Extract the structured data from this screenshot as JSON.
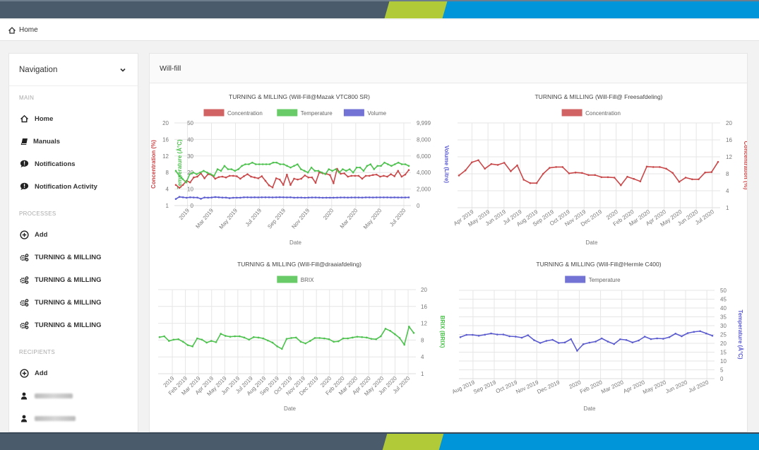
{
  "breadcrumb": {
    "icon": "home-icon",
    "label": "Home"
  },
  "sidebar": {
    "title": "Navigation",
    "sections": [
      {
        "label": "MAIN",
        "items": [
          {
            "label": "Home",
            "icon": "home-icon"
          },
          {
            "label": "Manuals",
            "icon": "book-icon"
          },
          {
            "label": "Notifications",
            "icon": "alert-bubble-icon"
          },
          {
            "label": "Notification Activity",
            "icon": "alert-bubble-icon"
          }
        ]
      },
      {
        "label": "PROCESSES",
        "items": [
          {
            "label": "Add",
            "icon": "plus-circle-icon"
          },
          {
            "label": "TURNING & MILLING",
            "icon": "cogs-icon"
          },
          {
            "label": "TURNING & MILLING",
            "icon": "cogs-icon"
          },
          {
            "label": "TURNING & MILLING",
            "icon": "cogs-icon"
          },
          {
            "label": "TURNING & MILLING",
            "icon": "cogs-icon"
          }
        ]
      },
      {
        "label": "RECIPIENTS",
        "items": [
          {
            "label": "Add",
            "icon": "plus-circle-icon"
          },
          {
            "label": "[redacted]",
            "icon": "user-icon",
            "blurred": true
          },
          {
            "label": "[redacted]",
            "icon": "user-icon",
            "blurred": true
          }
        ]
      }
    ]
  },
  "card": {
    "title": "Will-fill"
  },
  "colors": {
    "red": "#c9484a",
    "green": "#4ec24e",
    "blue": "#5b5bd0",
    "slate": "#4a5b6b",
    "lime": "#b1ca38",
    "cyan": "#0095d9"
  },
  "chart_data": [
    {
      "type": "line",
      "title": "TURNING & MILLING (Will-Fill@Mazak VTC800 SR)",
      "xlabel": "Date",
      "x_ticks": [
        "2019",
        "Mar 2019",
        "May 2019",
        "Jul 2019",
        "Sep 2019",
        "Nov 2019",
        "2020",
        "Mar 2020",
        "May 2020",
        "Jul 2020"
      ],
      "legend": [
        "Concentration",
        "Temperature",
        "Volume"
      ],
      "legend_position": "top",
      "grid": true,
      "axes": [
        {
          "id": "conc",
          "side": "left-outer",
          "label": "Concentration (%)",
          "color": "#c9484a",
          "ticks": [
            "20",
            "16",
            "12",
            "8",
            "4",
            "1"
          ],
          "range": [
            0,
            20
          ]
        },
        {
          "id": "temp",
          "side": "left-inner",
          "label": "Temperature (Â°C)",
          "color": "#4ec24e",
          "ticks": [
            "50",
            "40",
            "30",
            "20",
            "10",
            "0"
          ],
          "range": [
            0,
            50
          ]
        },
        {
          "id": "vol",
          "side": "right",
          "label": "Volume (Litre)",
          "color": "#5b5bd0",
          "ticks": [
            "9,999",
            "8,000",
            "6,000",
            "4,000",
            "2,000",
            "0"
          ],
          "range": [
            0,
            9999
          ]
        }
      ],
      "series": [
        {
          "name": "Concentration",
          "axis": "conc",
          "color": "#c9484a",
          "values": [
            5.0,
            4.3,
            5.0,
            6.0,
            5.6,
            6.8,
            7.0,
            7.8,
            6.6,
            7.6,
            7.4,
            6.5,
            6.9,
            7.0,
            6.8,
            7.2,
            7.2,
            7.1,
            6.5,
            7.1,
            7.6,
            7.0,
            6.8,
            6.6,
            7.1,
            6.0,
            4.9,
            4.4,
            6.6,
            6.3,
            5.0,
            7.5,
            5.0,
            6.5,
            6.3,
            6.5,
            7.3,
            6.8,
            6.8,
            5.5,
            8.0,
            7.8,
            7.7,
            7.4,
            5.4,
            8.9,
            7.7,
            7.8,
            7.0,
            7.2,
            7.2,
            7.2,
            6.5,
            7.2,
            7.2,
            7.4,
            7.5,
            7.0,
            7.2,
            7.0,
            7.6,
            7.1,
            8.4,
            7.0,
            7.5,
            8.6
          ]
        },
        {
          "name": "Temperature",
          "axis": "temp",
          "color": "#4ec24e",
          "values": [
            21,
            18,
            16,
            14,
            19,
            20,
            19,
            20,
            21,
            20,
            19,
            18,
            22,
            21,
            24,
            22,
            22,
            21,
            22,
            24,
            25,
            25,
            26,
            25,
            25,
            25,
            25,
            25,
            26,
            26,
            25,
            25,
            24,
            23,
            24,
            25,
            22,
            21,
            20,
            23,
            21,
            21,
            20,
            19,
            22,
            21,
            22,
            20,
            22,
            21,
            22,
            20,
            23,
            23,
            21,
            24,
            25,
            22,
            24,
            24,
            26,
            25,
            24,
            25,
            26,
            25,
            25,
            24
          ]
        },
        {
          "name": "Volume",
          "axis": "vol",
          "color": "#5b5bd0",
          "values": [
            800,
            1050,
            1000,
            950,
            1000,
            980,
            970,
            820,
            980,
            960,
            980,
            1030,
            1000,
            970,
            970,
            900,
            950,
            960,
            960,
            1000,
            1000,
            990,
            1000,
            990,
            1000,
            1000,
            1000,
            990,
            1000,
            1010,
            1000,
            990,
            1000,
            960,
            970,
            970,
            950,
            970,
            980,
            980,
            970,
            950,
            960,
            960,
            960,
            970,
            980,
            980,
            970,
            980,
            980,
            980,
            970,
            990,
            990,
            980,
            990,
            990,
            990,
            990,
            980,
            990,
            980,
            980,
            980,
            990
          ]
        }
      ]
    },
    {
      "type": "line",
      "title": "TURNING & MILLING (Will-Fill@ Freesafdeling)",
      "xlabel": "Date",
      "x_ticks": [
        "Apr 2019",
        "May 2019",
        "Jun 2019",
        "Jul 2019",
        "Aug 2019",
        "Sep 2019",
        "Oct 2019",
        "Nov 2019",
        "Dec 2019",
        "2020",
        "Feb 2020",
        "Mar 2020",
        "Apr 2020",
        "May 2020",
        "Jun 2020",
        "Jul 2020"
      ],
      "legend": [
        "Concentration"
      ],
      "legend_position": "top",
      "grid": true,
      "axes": [
        {
          "id": "conc",
          "side": "right",
          "label": "Concentration (%)",
          "color": "#c9484a",
          "ticks": [
            "20",
            "16",
            "12",
            "8",
            "4",
            "1"
          ],
          "range": [
            0,
            20
          ]
        }
      ],
      "series": [
        {
          "name": "Concentration",
          "axis": "conc",
          "color": "#c9484a",
          "values": [
            7.6,
            8.8,
            10.7,
            11.2,
            9.2,
            10.3,
            10.1,
            10.6,
            8.6,
            10.0,
            6.6,
            5.8,
            5.8,
            8.0,
            9.4,
            9.6,
            9.6,
            8.1,
            8.3,
            8.2,
            7.7,
            7.7,
            7.2,
            7.2,
            7.1,
            5.3,
            7.3,
            6.8,
            6.2,
            9.7,
            9.6,
            9.6,
            9.2,
            8.2,
            6.1,
            7.1,
            6.7,
            6.7,
            8.3,
            8.4,
            10.8
          ]
        }
      ]
    },
    {
      "type": "line",
      "title": "TURNING & MILLING (Will-Fill@draaiafdeling)",
      "xlabel": "Date",
      "x_ticks": [
        "2019",
        "Feb 2019",
        "Mar 2019",
        "Apr 2019",
        "May 2019",
        "Jun 2019",
        "Jul 2019",
        "Aug 2019",
        "Sep 2019",
        "Oct 2019",
        "Nov 2019",
        "Dec 2019",
        "2020",
        "Feb 2020",
        "Mar 2020",
        "Apr 2020",
        "May 2020",
        "Jun 2020",
        "Jul 2020"
      ],
      "legend": [
        "BRIX"
      ],
      "legend_position": "top",
      "grid": true,
      "axes": [
        {
          "id": "brix",
          "side": "right",
          "label": "BRIX (BRIX)",
          "color": "#4ec24e",
          "ticks": [
            "20",
            "16",
            "12",
            "8",
            "4",
            "1"
          ],
          "range": [
            0,
            20
          ]
        }
      ],
      "series": [
        {
          "name": "BRIX",
          "axis": "brix",
          "color": "#4ec24e",
          "values": [
            8.7,
            8.9,
            7.8,
            8.1,
            8.2,
            7.6,
            6.8,
            6.5,
            8.4,
            8.1,
            7.4,
            7.8,
            7.5,
            9.5,
            9.0,
            8.8,
            8.9,
            8.9,
            8.6,
            8.1,
            8.7,
            8.6,
            8.4,
            7.9,
            7.4,
            6.5,
            5.9,
            8.3,
            8.5,
            8.6,
            7.6,
            7.2,
            7.8,
            8.5,
            8.5,
            8.4,
            8.2,
            7.6,
            7.7,
            8.4,
            8.4,
            8.6,
            8.8,
            8.7,
            8.6,
            8.3,
            8.2,
            8.9,
            10.7,
            10.2,
            9.4,
            8.5,
            6.9,
            11.2,
            9.7
          ]
        }
      ]
    },
    {
      "type": "line",
      "title": "TURNING & MILLING (Will-Fill@Hermle C400)",
      "xlabel": "Date",
      "x_ticks": [
        "Aug 2019",
        "Sep 2019",
        "Oct 2019",
        "Nov 2019",
        "Dec 2019",
        "2020",
        "Feb 2020",
        "Mar 2020",
        "Apr 2020",
        "May 2020",
        "Jun 2020",
        "Jul 2020"
      ],
      "legend": [
        "Temperature"
      ],
      "legend_position": "top",
      "grid": true,
      "axes": [
        {
          "id": "temp",
          "side": "right",
          "label": "Temperature (Â°C)",
          "color": "#5b5bd0",
          "ticks": [
            "50",
            "45",
            "40",
            "35",
            "30",
            "25",
            "20",
            "15",
            "10",
            "5",
            "0"
          ],
          "range": [
            0,
            50
          ]
        }
      ],
      "series": [
        {
          "name": "Temperature",
          "axis": "temp",
          "color": "#5b5bd0",
          "values": [
            23.5,
            24.8,
            24.8,
            24.3,
            24.9,
            25.6,
            25.0,
            25.0,
            24.0,
            23.8,
            23.2,
            24.6,
            21.8,
            20.2,
            21.4,
            22.0,
            20.2,
            20.5,
            22.4,
            15.8,
            19.5,
            20.4,
            21.0,
            22.8,
            21.0,
            19.6,
            22.3,
            21.9,
            20.5,
            21.6,
            23.8,
            22.4,
            22.8,
            22.6,
            23.5,
            25.5,
            24.0,
            25.8,
            26.5,
            26.9,
            25.6,
            24.3
          ]
        }
      ]
    }
  ]
}
